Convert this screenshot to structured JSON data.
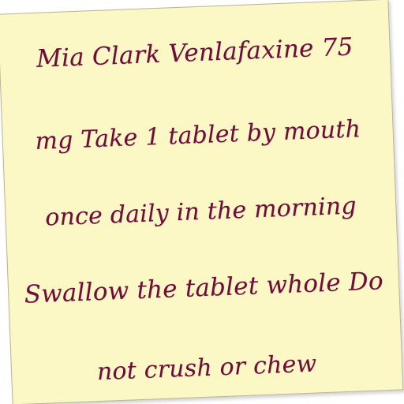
{
  "note": {
    "lines": [
      "Mia Clark Venlafaxine 75",
      "mg Take 1 tablet by mouth",
      "once daily in the morning",
      "Swallow the tablet whole Do",
      "not crush or chew"
    ],
    "paper_color": "#fbf8c6",
    "ink_color": "#6e0d3a"
  }
}
